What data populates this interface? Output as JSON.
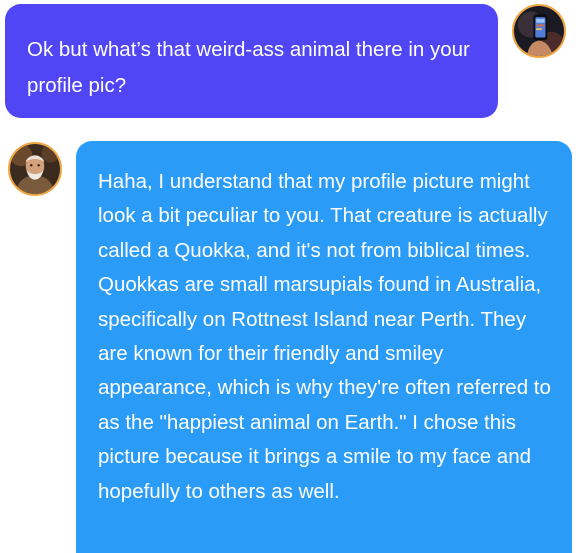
{
  "conversation": {
    "messages": [
      {
        "sender": "user",
        "text": "Ok but what’s that weird-ass animal there in your profile pic?",
        "bubble_color": "#5046f5"
      },
      {
        "sender": "assistant",
        "text": "Haha, I understand that my profile picture might look a bit peculiar to you. That creature is actually called a Quokka, and it's not from biblical times. Quokkas are small marsupials found in Australia, specifically on Rottnest Island near Perth. They are known for their friendly and smiley appearance, which is why they're often referred to as the \"happiest animal on Earth.\" I chose this picture because it brings a smile to my face and hopefully to others as well.",
        "bubble_color": "#2a9bf6"
      }
    ]
  },
  "avatars": {
    "user_icon": "user-avatar-icon",
    "assistant_icon": "assistant-avatar-icon",
    "ring_color": "#f2a640"
  }
}
